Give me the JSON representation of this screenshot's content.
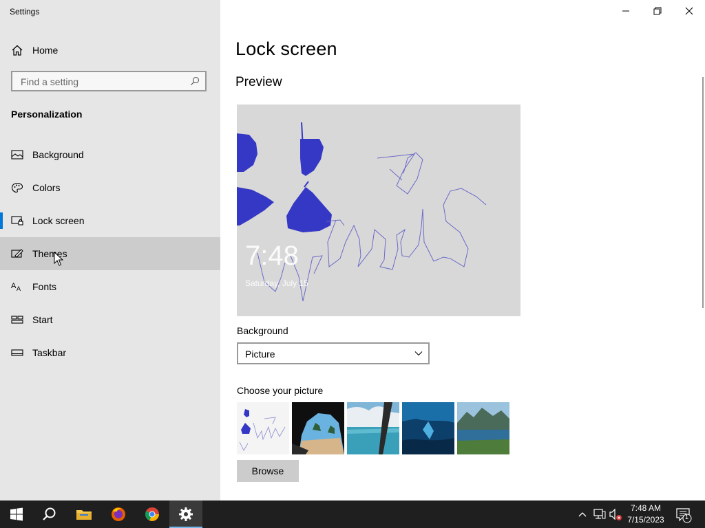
{
  "window": {
    "title": "Settings"
  },
  "sidebar": {
    "home_label": "Home",
    "search_placeholder": "Find a setting",
    "section_title": "Personalization",
    "items": [
      {
        "label": "Background",
        "icon": "picture-icon"
      },
      {
        "label": "Colors",
        "icon": "palette-icon"
      },
      {
        "label": "Lock screen",
        "icon": "lock-screen-icon",
        "selected": true
      },
      {
        "label": "Themes",
        "icon": "themes-icon",
        "hovered": true
      },
      {
        "label": "Fonts",
        "icon": "fonts-icon"
      },
      {
        "label": "Start",
        "icon": "start-icon"
      },
      {
        "label": "Taskbar",
        "icon": "taskbar-icon"
      }
    ]
  },
  "main": {
    "title": "Lock screen",
    "preview_heading": "Preview",
    "preview_time": "7:48",
    "preview_date": "Saturday, July 15",
    "background_label": "Background",
    "background_value": "Picture",
    "choose_picture_label": "Choose your picture",
    "browse_label": "Browse"
  },
  "taskbar": {
    "time": "7:48 AM",
    "date": "7/15/2023",
    "notification_count": "1",
    "accent_color": "#76b9ed"
  },
  "colors": {
    "sidebar_bg": "#e6e6e6",
    "hover_bg": "#cccccc",
    "accent": "#0078d7",
    "taskbar_bg": "#1f1f1f"
  }
}
